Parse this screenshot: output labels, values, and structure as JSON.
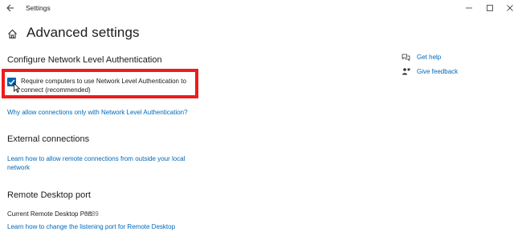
{
  "window": {
    "title": "Settings",
    "controls": {
      "minimize": "minimize-icon",
      "maximize": "maximize-icon",
      "close": "close-icon"
    }
  },
  "page": {
    "title": "Advanced settings"
  },
  "nla": {
    "section_title": "Configure Network Level Authentication",
    "checkbox_label": "Require computers to use Network Level Authentication to connect (recommended)",
    "checked": true,
    "link": "Why allow connections only with Network Level Authentication?"
  },
  "external": {
    "section_title": "External connections",
    "link": "Learn how to allow remote connections from outside your local network"
  },
  "port": {
    "section_title": "Remote Desktop port",
    "label": "Current Remote Desktop Port",
    "value": "3389",
    "link": "Learn how to change the listening port for Remote Desktop"
  },
  "sidebar": {
    "help": {
      "label": "Get help",
      "icon": "help-chat-icon"
    },
    "feedback": {
      "label": "Give feedback",
      "icon": "feedback-icon"
    }
  },
  "colors": {
    "accent": "#0067b8",
    "highlight": "#ee1c1c",
    "checkbox": "#0063b1"
  }
}
